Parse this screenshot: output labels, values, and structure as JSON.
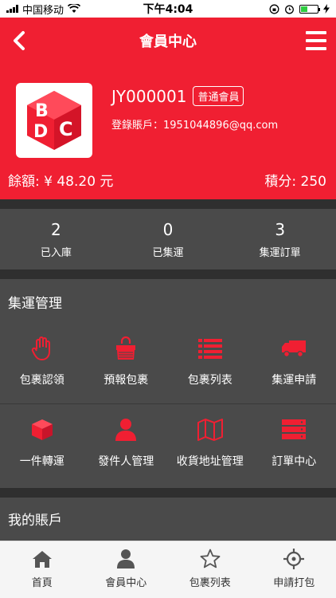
{
  "status_bar": {
    "carrier": "中国移动",
    "time": "下午4:04"
  },
  "header": {
    "title": "會員中心"
  },
  "profile": {
    "user_id": "JY000001",
    "member_level": "普通會員",
    "account_label": "登錄賬戶：",
    "account_value": "1951044896@qq.com",
    "balance_text": "餘額: ¥ 48.20 元",
    "points_text": "積分: 250"
  },
  "stats": [
    {
      "value": "2",
      "label": "已入庫"
    },
    {
      "value": "0",
      "label": "已集運"
    },
    {
      "value": "3",
      "label": "集運訂單"
    }
  ],
  "management": {
    "title": "集運管理",
    "items": [
      {
        "label": "包裹認領",
        "icon": "hand-icon"
      },
      {
        "label": "預報包裹",
        "icon": "bag-icon"
      },
      {
        "label": "包裹列表",
        "icon": "list-icon"
      },
      {
        "label": "集運申請",
        "icon": "truck-icon"
      },
      {
        "label": "一件轉運",
        "icon": "box-icon"
      },
      {
        "label": "發件人管理",
        "icon": "user-icon"
      },
      {
        "label": "收貨地址管理",
        "icon": "map-icon"
      },
      {
        "label": "訂單中心",
        "icon": "server-icon"
      }
    ]
  },
  "account_section": {
    "title": "我的賬戶"
  },
  "tabbar": [
    {
      "label": "首頁",
      "icon": "home-icon"
    },
    {
      "label": "會員中心",
      "icon": "user-icon"
    },
    {
      "label": "包裹列表",
      "icon": "star-icon"
    },
    {
      "label": "申請打包",
      "icon": "crosshair-icon"
    }
  ],
  "colors": {
    "brand_red": "#f01f32",
    "panel_gray": "#4a4a4a",
    "divider_dark": "#2f2f2f"
  }
}
